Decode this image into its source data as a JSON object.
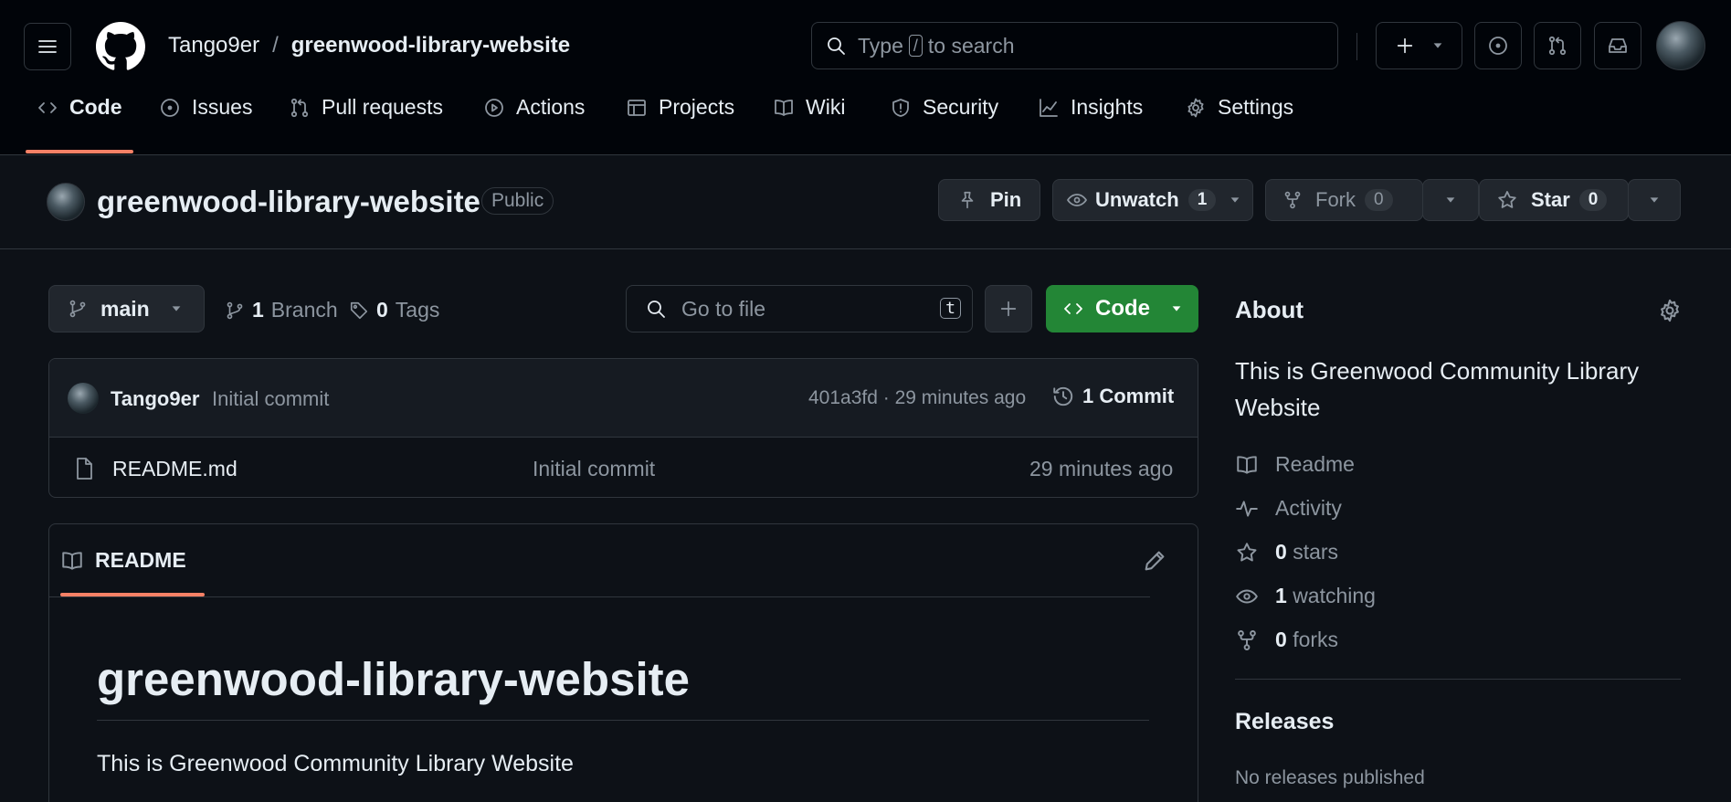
{
  "header": {
    "owner": "Tango9er",
    "separator": "/",
    "repo": "greenwood-library-website",
    "search": {
      "prefix": "Type",
      "key": "/",
      "suffix": "to search"
    }
  },
  "nav": {
    "tabs": [
      {
        "label": "Code",
        "icon": "code-icon",
        "active": true
      },
      {
        "label": "Issues",
        "icon": "issues-icon"
      },
      {
        "label": "Pull requests",
        "icon": "pull-request-icon"
      },
      {
        "label": "Actions",
        "icon": "play-icon"
      },
      {
        "label": "Projects",
        "icon": "table-icon"
      },
      {
        "label": "Wiki",
        "icon": "book-icon"
      },
      {
        "label": "Security",
        "icon": "shield-icon"
      },
      {
        "label": "Insights",
        "icon": "graph-icon"
      },
      {
        "label": "Settings",
        "icon": "gear-icon"
      }
    ]
  },
  "repo_header": {
    "title": "greenwood-library-website",
    "visibility": "Public",
    "pin_label": "Pin",
    "unwatch_label": "Unwatch",
    "watch_count": "1",
    "fork_label": "Fork",
    "fork_count": "0",
    "star_label": "Star",
    "star_count": "0"
  },
  "toolbar": {
    "branch": "main",
    "branches_count": "1",
    "branches_label": "Branch",
    "tags_count": "0",
    "tags_label": "Tags",
    "goto_placeholder": "Go to file",
    "goto_key": "t",
    "code_label": "Code"
  },
  "commit": {
    "author": "Tango9er",
    "message": "Initial commit",
    "hash_time": "401a3fd · 29 minutes ago",
    "count_label": "1 Commit"
  },
  "files": [
    {
      "name": "README.md",
      "commit": "Initial commit",
      "time": "29 minutes ago"
    }
  ],
  "readme": {
    "tab_label": "README",
    "heading": "greenwood-library-website",
    "body": "This is Greenwood Community Library Website"
  },
  "about": {
    "title": "About",
    "description": "This is Greenwood Community Library Website",
    "items": {
      "readme": "Readme",
      "activity": "Activity",
      "stars_count": "0",
      "stars_label": "stars",
      "watching_count": "1",
      "watching_label": "watching",
      "forks_count": "0",
      "forks_label": "forks"
    }
  },
  "releases": {
    "title": "Releases",
    "empty": "No releases published"
  },
  "colors": {
    "background": "#0d1117",
    "header": "#010409",
    "border": "#30363d",
    "accent_underline": "#f78166",
    "code_button": "#238636",
    "muted_text": "#8d96a0"
  }
}
